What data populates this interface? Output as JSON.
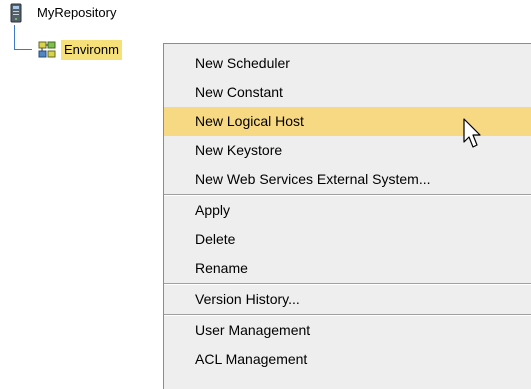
{
  "tree": {
    "root": {
      "label": "MyRepository",
      "icon": "server-icon"
    },
    "environment": {
      "label": "Environm",
      "icon": "environment-icon",
      "selected": true
    }
  },
  "context_menu": {
    "groups": [
      [
        {
          "label": "New Scheduler",
          "highlighted": false
        },
        {
          "label": "New Constant",
          "highlighted": false
        },
        {
          "label": "New Logical Host",
          "highlighted": true
        },
        {
          "label": "New Keystore",
          "highlighted": false
        },
        {
          "label": "New Web Services External System...",
          "highlighted": false
        }
      ],
      [
        {
          "label": "Apply",
          "highlighted": false
        },
        {
          "label": "Delete",
          "highlighted": false
        },
        {
          "label": "Rename",
          "highlighted": false
        }
      ],
      [
        {
          "label": "Version History...",
          "highlighted": false
        }
      ],
      [
        {
          "label": "User Management",
          "highlighted": false
        },
        {
          "label": "ACL Management",
          "highlighted": false
        }
      ]
    ]
  },
  "colors": {
    "highlight": "#f6d982",
    "selection": "#f6e07a",
    "menu_bg": "#eeeeee",
    "tree_line": "#3a7ac8"
  },
  "cursor": {
    "icon": "arrow-cursor-icon"
  }
}
